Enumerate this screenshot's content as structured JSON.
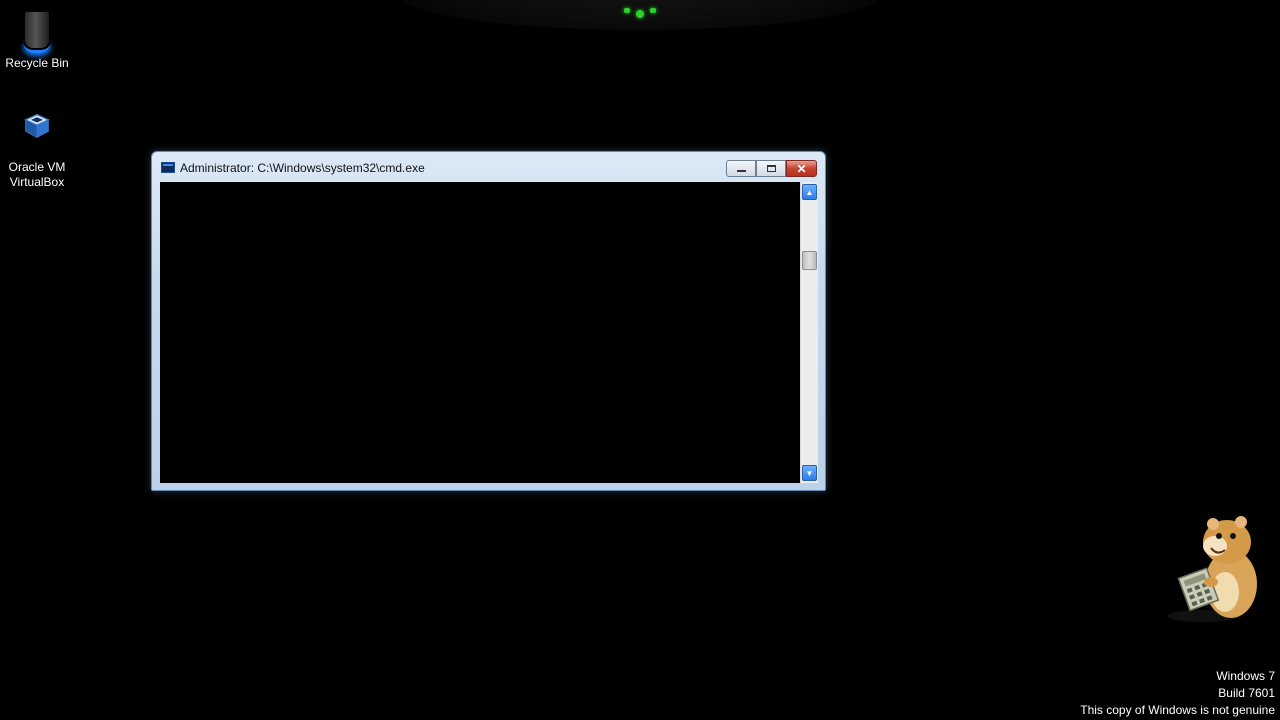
{
  "desktop": {
    "icons": [
      {
        "label": "Recycle Bin",
        "icon": "recycle-bin-icon"
      },
      {
        "label_line1": "Oracle VM",
        "label_line2": "VirtualBox",
        "icon": "virtualbox-icon"
      }
    ]
  },
  "window": {
    "title": "Administrator: C:\\Windows\\system32\\cmd.exe",
    "icon": "cmd-icon",
    "buttons": {
      "minimize": "minimize-icon",
      "maximize": "maximize-icon",
      "close": "✕"
    },
    "console_bg": "#000000",
    "scroll_position": 0.2
  },
  "watermark": {
    "line1": "Windows 7",
    "line2": "Build 7601",
    "line3": "This copy of Windows is not genuine"
  },
  "colors": {
    "accent_green": "#2bd12b",
    "selection_blue": "#2d7de8",
    "close_red": "#c74433"
  }
}
